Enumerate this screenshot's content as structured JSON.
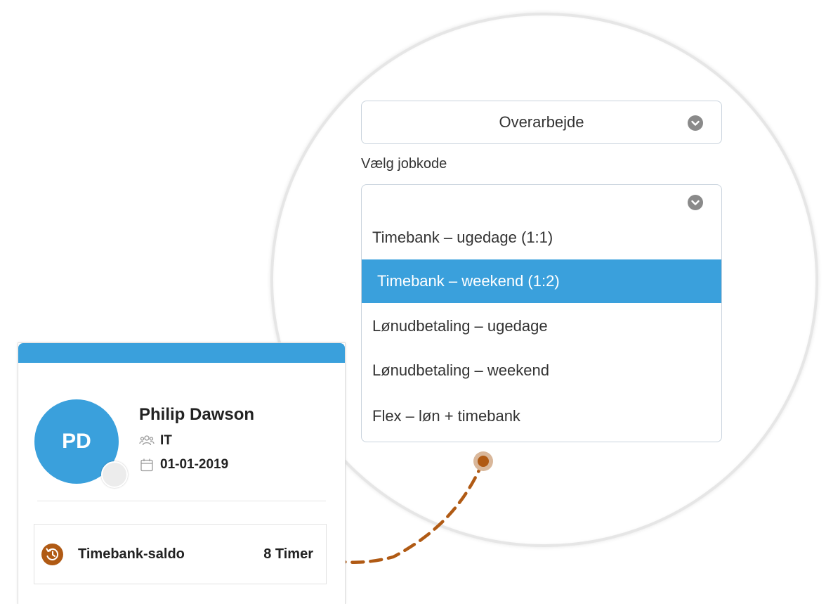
{
  "overtime_select": {
    "value": "Overarbejde",
    "icon": "chevron-down-icon"
  },
  "jobcode": {
    "label": "Vælg jobkode",
    "icon": "chevron-down-icon",
    "options": [
      {
        "label": "Timebank – ugedage (1:1)",
        "selected": false
      },
      {
        "label": "Timebank – weekend (1:2)",
        "selected": true
      },
      {
        "label": "Lønudbetaling – ugedage",
        "selected": false
      },
      {
        "label": "Lønudbetaling – weekend",
        "selected": false
      },
      {
        "label": "Flex – løn + timebank",
        "selected": false
      }
    ]
  },
  "employee": {
    "initials": "PD",
    "name": "Philip Dawson",
    "department": "IT",
    "department_icon": "team-icon",
    "date": "01-01-2019",
    "date_icon": "calendar-icon"
  },
  "balance": {
    "label": "Timebank-saldo",
    "value": "8 Timer",
    "icon": "history-icon"
  },
  "colors": {
    "accent_blue": "#3aa0dc",
    "accent_brown": "#b05a14"
  }
}
